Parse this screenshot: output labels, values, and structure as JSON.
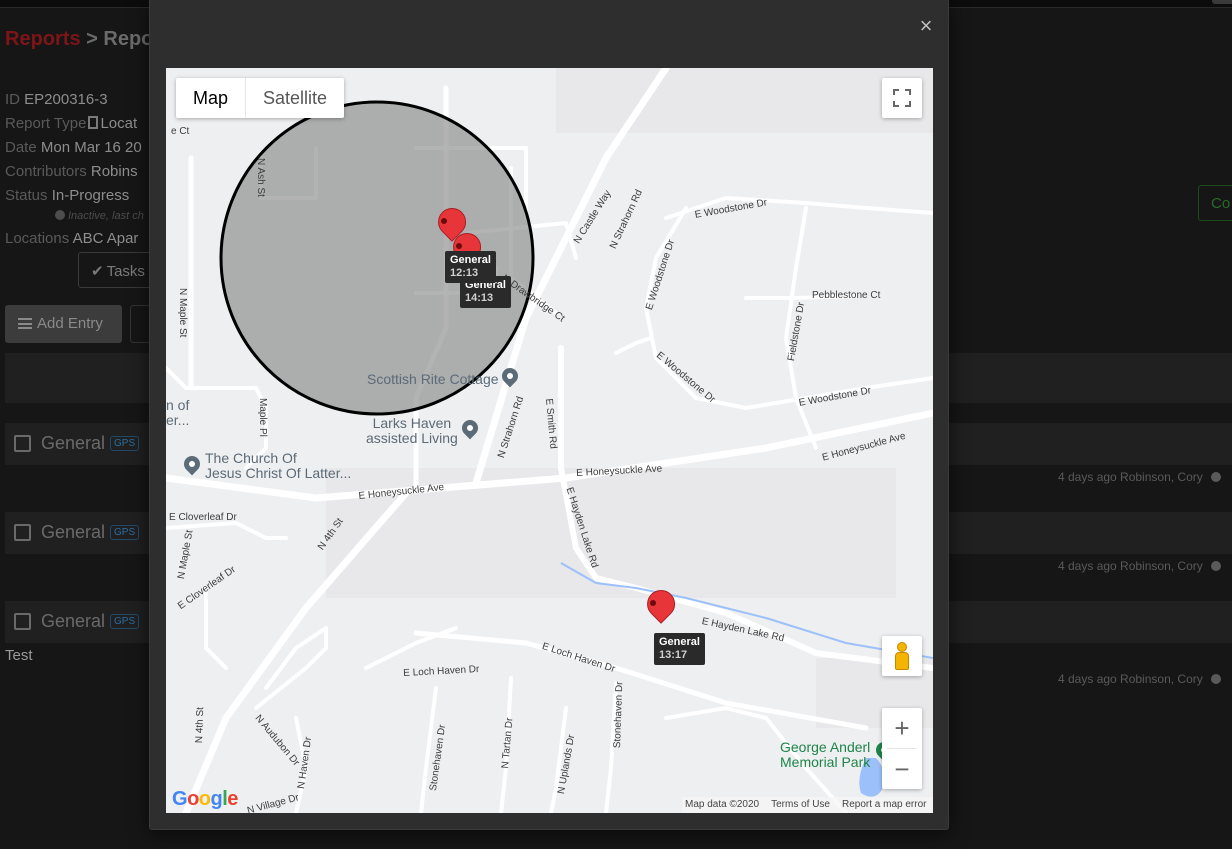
{
  "page": {
    "breadcrumb": {
      "link": "Reports",
      "sep": " > ",
      "current": "Repor"
    },
    "meta": [
      {
        "key": "ID",
        "value": "EP200316-3"
      },
      {
        "key": "Report Type",
        "value": "Locat"
      },
      {
        "key": "Date",
        "value": "Mon Mar 16 20"
      },
      {
        "key": "Contributors",
        "value": "Robins"
      },
      {
        "key": "Status",
        "value": "In-Progress"
      },
      {
        "key": "Locations",
        "value": "ABC Apar"
      }
    ],
    "inactive_note": "Inactive, last ch",
    "tasks_label": "Tasks",
    "add_entry_label": "Add Entry",
    "right_button_label": "Co",
    "entries": [
      {
        "label": "General",
        "badge": "GPS",
        "meta": "4 days ago Robinson, Cory"
      },
      {
        "label": "General",
        "badge": "GPS",
        "meta": "4 days ago Robinson, Cory"
      },
      {
        "label": "General",
        "badge": "GPS",
        "meta": "4 days ago Robinson, Cory"
      }
    ],
    "note_text": "Test"
  },
  "modal": {
    "close_label": "×",
    "map": {
      "type_buttons": [
        {
          "label": "Map",
          "active": true
        },
        {
          "label": "Satellite",
          "active": false
        }
      ],
      "zoom_in": "+",
      "zoom_out": "−",
      "google_logo": "Google",
      "attribution": {
        "data": "Map data ©2020",
        "terms": "Terms of Use",
        "report": "Report a map error"
      },
      "markers": [
        {
          "name": "General",
          "time": "12:13"
        },
        {
          "name": "General",
          "time": "14:13"
        },
        {
          "name": "General",
          "time": "13:17"
        }
      ],
      "pois": [
        {
          "name": "Scottish Rite Cottage"
        },
        {
          "name_line1": "Larks Haven",
          "name_line2": "assisted Living"
        },
        {
          "name_line1": "The Church Of",
          "name_line2": "Jesus Christ Of Latter..."
        },
        {
          "name_line1": "George Anderl",
          "name_line2": "Memorial Park"
        },
        {
          "name_line1": "n of",
          "name_line2": "er..."
        }
      ],
      "road_labels": {
        "woodstone_dr_1": "E Woodstone Dr",
        "woodstone_dr_2": "E Woodstone Dr",
        "woodstone_dr_3": "E Woodstone Dr",
        "woodstone_dr_4": "E Woodstone Dr",
        "pebblestone": "Pebblestone Ct",
        "fieldstone": "Fieldstone Dr",
        "strahorn_1": "N Strahorn Rd",
        "strahorn_2": "N Strahorn Rd",
        "castle_way": "N Castle Way",
        "drawbridge": "N Drawbridge Ct",
        "honeysuckle_1": "E Honeysuckle Ave",
        "honeysuckle_2": "E Honeysuckle Ave",
        "honeysuckle_3": "E Honeysuckle Ave",
        "smith_rd": "E Smith Rd",
        "hayden_lake_rd": "E Hayden Lake Rd",
        "hayden_lake_rd_2": "E Hayden Lake Rd",
        "loch_haven_1": "E Loch Haven Dr",
        "loch_haven_2": "E Loch Haven Dr",
        "n_4th_1": "N 4th St",
        "n_4th_2": "N 4th St",
        "maple_st_1": "N Maple St",
        "maple_st_2": "N Maple St",
        "maple_pl": "Maple Pl",
        "cloverleaf_1": "E Cloverleaf Dr",
        "cloverleaf_2": "E Cloverleaf Dr",
        "ash_st": "N Ash St",
        "ash_ct": "e Ct",
        "audubon": "N Audubon Dr",
        "haven_dr": "N Haven Dr",
        "stonehaven_1": "Stonehaven Dr",
        "stonehaven_2": "Stonehaven Dr",
        "tartan": "N Tartan Dr",
        "uplands": "N Uplands Dr",
        "village": "N Village Dr"
      }
    }
  },
  "colors": {
    "brand_red": "#7d1518",
    "marker_red": "#e8353a",
    "gps_blue": "#2b6ea0",
    "green_button": "#2a6a2a"
  }
}
